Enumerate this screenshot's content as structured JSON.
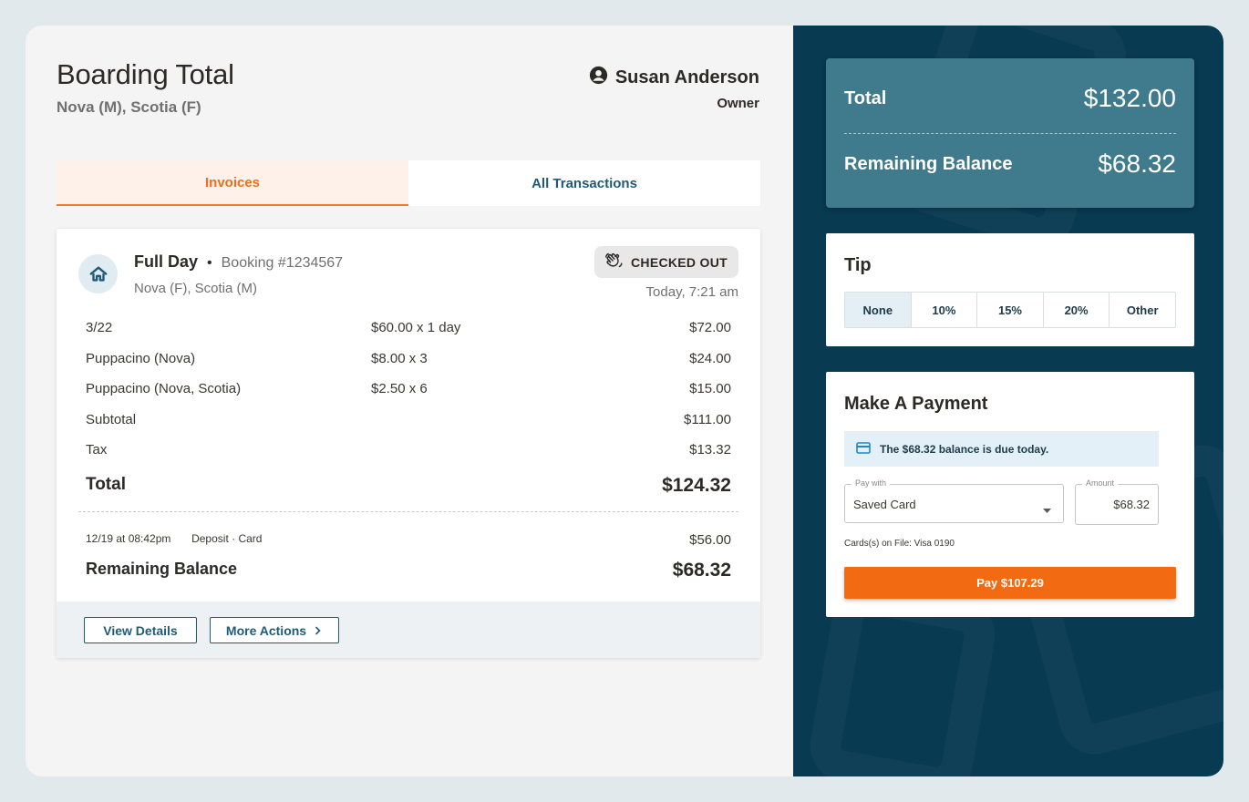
{
  "header": {
    "title": "Boarding Total",
    "pets": "Nova (M), Scotia (F)",
    "owner_name": "Susan Anderson",
    "owner_role": "Owner"
  },
  "tabs": [
    {
      "label": "Invoices",
      "active": true
    },
    {
      "label": "All Transactions",
      "active": false
    }
  ],
  "invoice": {
    "service": "Full Day",
    "separator": "•",
    "booking": "Booking #1234567",
    "pets": "Nova (F), Scotia (M)",
    "status": "CHECKED OUT",
    "time": "Today, 7:21 am",
    "lines": [
      {
        "label": "3/22",
        "rate": "$60.00 x 1 day",
        "amount": "$72.00"
      },
      {
        "label": "Puppacino (Nova)",
        "rate": "$8.00 x 3",
        "amount": "$24.00"
      },
      {
        "label": "Puppacino (Nova, Scotia)",
        "rate": "$2.50 x 6",
        "amount": "$15.00"
      },
      {
        "label": "Subtotal",
        "rate": "",
        "amount": "$111.00"
      },
      {
        "label": "Tax",
        "rate": "",
        "amount": "$13.32"
      }
    ],
    "total_label": "Total",
    "total_value": "$124.32",
    "deposit_date": "12/19 at 08:42pm",
    "deposit_desc": "Deposit · Card",
    "deposit_amount": "$56.00",
    "remaining_label": "Remaining Balance",
    "remaining_value": "$68.32",
    "view_details": "View Details",
    "more_actions": "More Actions"
  },
  "summary": {
    "total_label": "Total",
    "total_value": "$132.00",
    "remaining_label": "Remaining Balance",
    "remaining_value": "$68.32"
  },
  "tip": {
    "title": "Tip",
    "options": [
      "None",
      "10%",
      "15%",
      "20%",
      "Other"
    ],
    "selected": "None"
  },
  "payment": {
    "title": "Make A Payment",
    "notice": "The $68.32 balance is due today.",
    "pay_with_label": "Pay with",
    "pay_with_value": "Saved Card",
    "amount_label": "Amount",
    "amount_value": "$68.32",
    "cards_on_file": "Cards(s) on File: Visa 0190",
    "pay_button": "Pay $107.29"
  },
  "colors": {
    "accent_orange": "#f26b12",
    "navy": "#083a52",
    "teal": "#3f7a8d",
    "link_blue": "#1f5b78"
  }
}
